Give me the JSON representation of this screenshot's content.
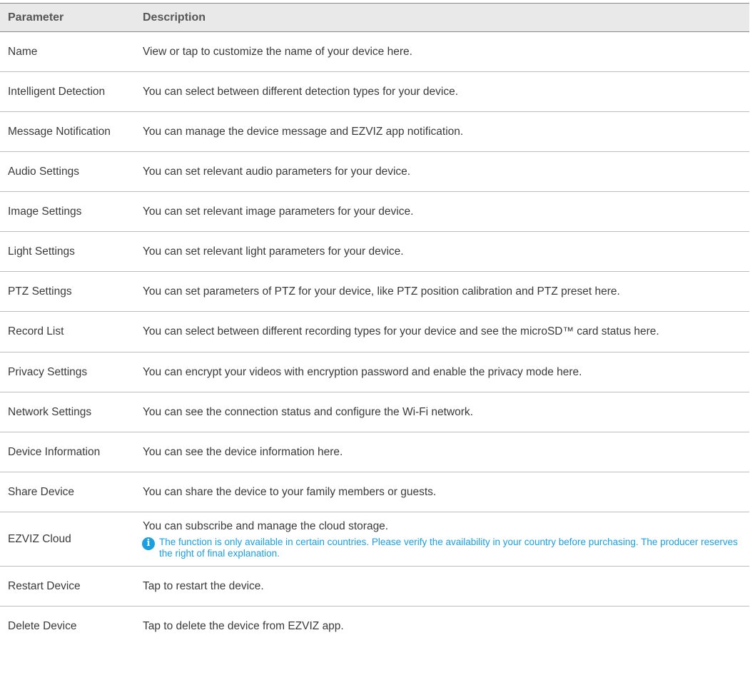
{
  "header": {
    "parameter": "Parameter",
    "description": "Description"
  },
  "rows": [
    {
      "parameter": "Name",
      "description": "View or tap to customize the name of your device here."
    },
    {
      "parameter": "Intelligent Detection",
      "description": "You can select between different detection types for your device."
    },
    {
      "parameter": "Message Notification",
      "description": "You can manage the device message and EZVIZ app notification."
    },
    {
      "parameter": "Audio Settings",
      "description": "You can set relevant audio parameters for your device."
    },
    {
      "parameter": "Image Settings",
      "description": "You can set relevant image parameters for your device."
    },
    {
      "parameter": "Light Settings",
      "description": "You can set relevant light parameters for your device."
    },
    {
      "parameter": "PTZ Settings",
      "description": "You can set parameters of PTZ for your device, like PTZ position calibration and PTZ preset here."
    },
    {
      "parameter": "Record List",
      "description": "You can select between different recording types for your device and see the microSD™ card status here."
    },
    {
      "parameter": "Privacy Settings",
      "description": "You can encrypt your videos with encryption password and enable the privacy mode here."
    },
    {
      "parameter": "Network Settings",
      "description": "You can see the connection status and configure the Wi-Fi network."
    },
    {
      "parameter": "Device Information",
      "description": "You can see the device information here."
    },
    {
      "parameter": "Share Device",
      "description": "You can share the device to your family members or guests."
    },
    {
      "parameter": "EZVIZ Cloud",
      "description": "You can subscribe and manage the cloud storage.",
      "note": "The function is only available in certain countries. Please verify the availability in your country before purchasing. The producer reserves the right of final explanation."
    },
    {
      "parameter": "Restart Device",
      "description": "Tap to restart the device."
    },
    {
      "parameter": "Delete Device",
      "description": "Tap to delete the device from EZVIZ app."
    }
  ],
  "icons": {
    "note": "info-icon"
  },
  "colors": {
    "header_bg": "#e9e9e9",
    "note_accent": "#1aa0e2"
  }
}
